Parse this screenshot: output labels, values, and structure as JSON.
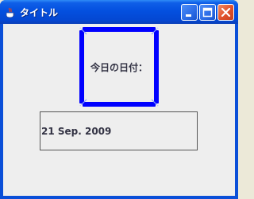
{
  "window": {
    "title": "タイトル",
    "icons": {
      "app": "java-cup-icon",
      "minimize": "minimize-icon",
      "maximize": "maximize-icon",
      "close": "close-icon"
    }
  },
  "content": {
    "label": "今日の日付：",
    "date": "21 Sep. 2009"
  },
  "colors": {
    "titlebar": "#0450df",
    "frame_border": "#0000ff",
    "client_background": "#eeeeee",
    "close_button": "#e0502a"
  }
}
